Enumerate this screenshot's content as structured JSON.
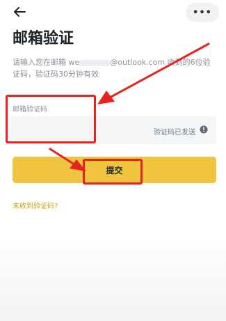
{
  "header": {
    "back_icon": "arrow-left-icon",
    "more_icon": "ellipsis-icon",
    "more_label": "•••"
  },
  "page": {
    "title": "邮箱验证",
    "description_prefix": "请输入您在邮箱 we",
    "description_suffix": "@outlook.com 收到的6位验证码，验证码30分钟有效"
  },
  "form": {
    "code_label": "邮箱验证码",
    "code_value": "",
    "sent_status": "验证码已发送",
    "info_icon": "info-circle-icon"
  },
  "submit": {
    "label": "提交"
  },
  "resend": {
    "link_text": "未收到验证码?"
  },
  "colors": {
    "accent": "#f0c43e",
    "annotation": "#e8231f",
    "link": "#c9a016"
  }
}
